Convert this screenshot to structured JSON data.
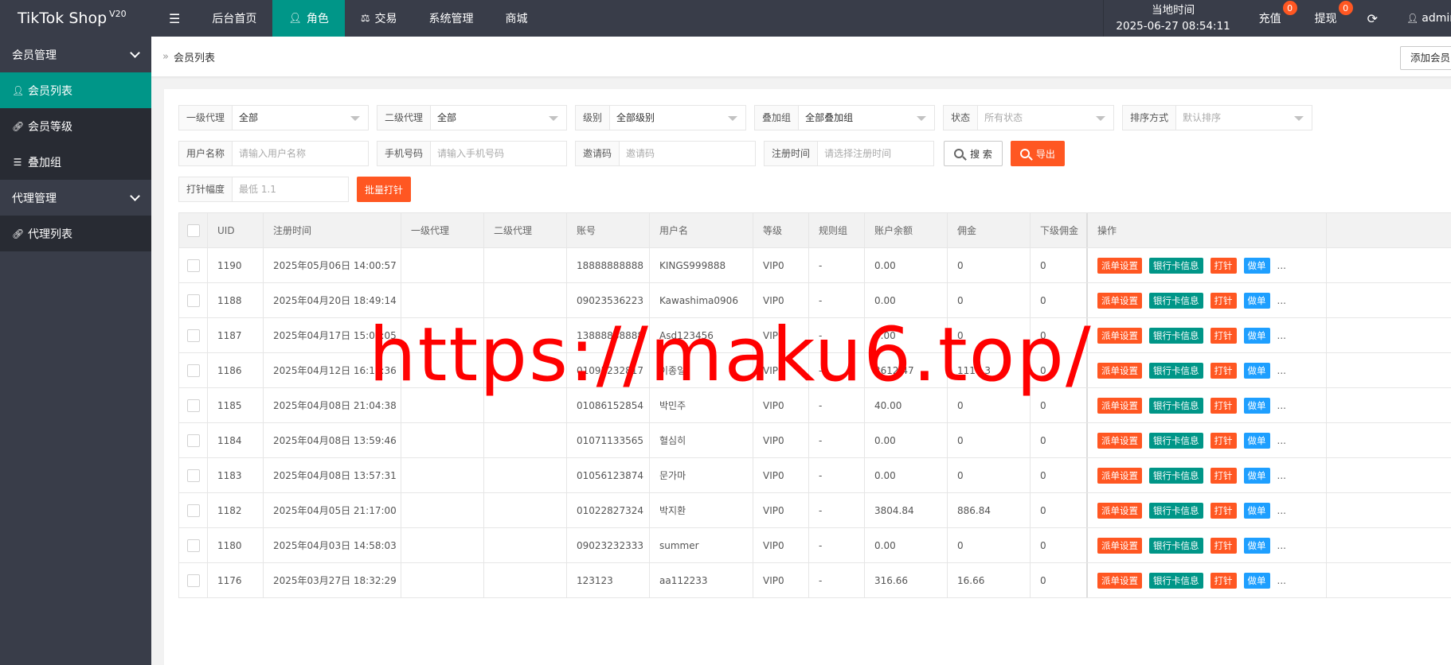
{
  "app": {
    "logo": "TikTok Shop",
    "version": "V20"
  },
  "topnav": {
    "toggle_icon": "menu-fold-icon",
    "items": [
      {
        "label": "后台首页",
        "icon": "",
        "active": false
      },
      {
        "label": "角色",
        "icon": "user-icon",
        "active": true
      },
      {
        "label": "交易",
        "icon": "scale-icon",
        "active": false
      },
      {
        "label": "系统管理",
        "icon": "",
        "active": false
      },
      {
        "label": "商城",
        "icon": "",
        "active": false
      }
    ]
  },
  "topright": {
    "clock_label": "当地时间",
    "clock_value": "2025-06-27 08:54:11",
    "recharge_label": "充值",
    "recharge_badge": "0",
    "withdraw_label": "提现",
    "withdraw_badge": "0",
    "user_label": "admin"
  },
  "sidebar": {
    "groups": [
      {
        "label": "会员管理",
        "items": [
          {
            "label": "会员列表",
            "icon": "user-icon",
            "active": true
          },
          {
            "label": "会员等级",
            "icon": "link-icon",
            "active": false
          },
          {
            "label": "叠加组",
            "icon": "list-icon",
            "active": false
          }
        ]
      },
      {
        "label": "代理管理",
        "items": [
          {
            "label": "代理列表",
            "icon": "link-icon",
            "active": false
          }
        ]
      }
    ]
  },
  "breadcrumb": {
    "current": "会员列表"
  },
  "add_button_label": "添加会员",
  "filters": {
    "agent1": {
      "label": "一级代理",
      "value": "全部"
    },
    "agent2": {
      "label": "二级代理",
      "value": "全部"
    },
    "level": {
      "label": "级别",
      "value": "全部级别"
    },
    "group": {
      "label": "叠加组",
      "value": "全部叠加组"
    },
    "status": {
      "label": "状态",
      "placeholder": "所有状态"
    },
    "sort": {
      "label": "排序方式",
      "placeholder": "默认排序"
    },
    "username": {
      "label": "用户名称",
      "placeholder": "请输入用户名称"
    },
    "phone": {
      "label": "手机号码",
      "placeholder": "请输入手机号码"
    },
    "invite": {
      "label": "邀请码",
      "placeholder": "邀请码"
    },
    "regtime": {
      "label": "注册时间",
      "placeholder": "请选择注册时间"
    },
    "search_btn": "搜 索",
    "export_btn": "导出",
    "range": {
      "label": "打针幅度",
      "placeholder": "最低 1.1"
    },
    "batch_btn": "批量打针"
  },
  "table": {
    "headers": [
      "UID",
      "注册时间",
      "一级代理",
      "二级代理",
      "账号",
      "用户名",
      "等级",
      "规则组",
      "账户余额",
      "佣金",
      "下级佣金",
      "操作"
    ],
    "op_labels": {
      "dispatch": "派单设置",
      "bank": "银行卡信息",
      "inject": "打针",
      "order": "做单",
      "more": "..."
    },
    "rows": [
      {
        "uid": "1190",
        "time": "2025年05月06日 14:00:57",
        "a1": "",
        "a2": "",
        "account": "18888888888",
        "name": "KINGS999888",
        "level": "VIP0",
        "group": "-",
        "balance": "0.00",
        "commission": "0",
        "sub": "0"
      },
      {
        "uid": "1188",
        "time": "2025年04月20日 18:49:14",
        "a1": "",
        "a2": "",
        "account": "09023536223",
        "name": "Kawashima0906",
        "level": "VIP0",
        "group": "-",
        "balance": "0.00",
        "commission": "0",
        "sub": "0"
      },
      {
        "uid": "1187",
        "time": "2025年04月17日 15:07:05",
        "a1": "",
        "a2": "",
        "account": "13888888888",
        "name": "Asd123456",
        "level": "VIP0",
        "group": "-",
        "balance": "0.00",
        "commission": "0",
        "sub": "0"
      },
      {
        "uid": "1186",
        "time": "2025年04月12日 16:18:36",
        "a1": "",
        "a2": "",
        "account": "01095232817",
        "name": "이종일",
        "level": "VIP0",
        "group": "-",
        "balance": "3612.47",
        "commission": "1118.3",
        "sub": "0"
      },
      {
        "uid": "1185",
        "time": "2025年04月08日 21:04:38",
        "a1": "",
        "a2": "",
        "account": "01086152854",
        "name": "박민주",
        "level": "VIP0",
        "group": "-",
        "balance": "40.00",
        "commission": "0",
        "sub": "0"
      },
      {
        "uid": "1184",
        "time": "2025年04月08日 13:59:46",
        "a1": "",
        "a2": "",
        "account": "01071133565",
        "name": "혈심히",
        "level": "VIP0",
        "group": "-",
        "balance": "0.00",
        "commission": "0",
        "sub": "0"
      },
      {
        "uid": "1183",
        "time": "2025年04月08日 13:57:31",
        "a1": "",
        "a2": "",
        "account": "01056123874",
        "name": "문가마",
        "level": "VIP0",
        "group": "-",
        "balance": "0.00",
        "commission": "0",
        "sub": "0"
      },
      {
        "uid": "1182",
        "time": "2025年04月05日 21:17:00",
        "a1": "",
        "a2": "",
        "account": "01022827324",
        "name": "박지환",
        "level": "VIP0",
        "group": "-",
        "balance": "3804.84",
        "commission": "886.84",
        "sub": "0"
      },
      {
        "uid": "1180",
        "time": "2025年04月03日 14:58:03",
        "a1": "",
        "a2": "",
        "account": "09023232333",
        "name": "summer",
        "level": "VIP0",
        "group": "-",
        "balance": "0.00",
        "commission": "0",
        "sub": "0"
      },
      {
        "uid": "1176",
        "time": "2025年03月27日 18:32:29",
        "a1": "",
        "a2": "",
        "account": "123123",
        "name": "aa112233",
        "level": "VIP0",
        "group": "-",
        "balance": "316.66",
        "commission": "16.66",
        "sub": "0"
      }
    ]
  },
  "watermark": "https://maku6.top/",
  "colors": {
    "topbar": "#393d49",
    "accent": "#009688",
    "orange": "#ff5722",
    "blue": "#1e9fff",
    "watermark": "#ff0000"
  }
}
